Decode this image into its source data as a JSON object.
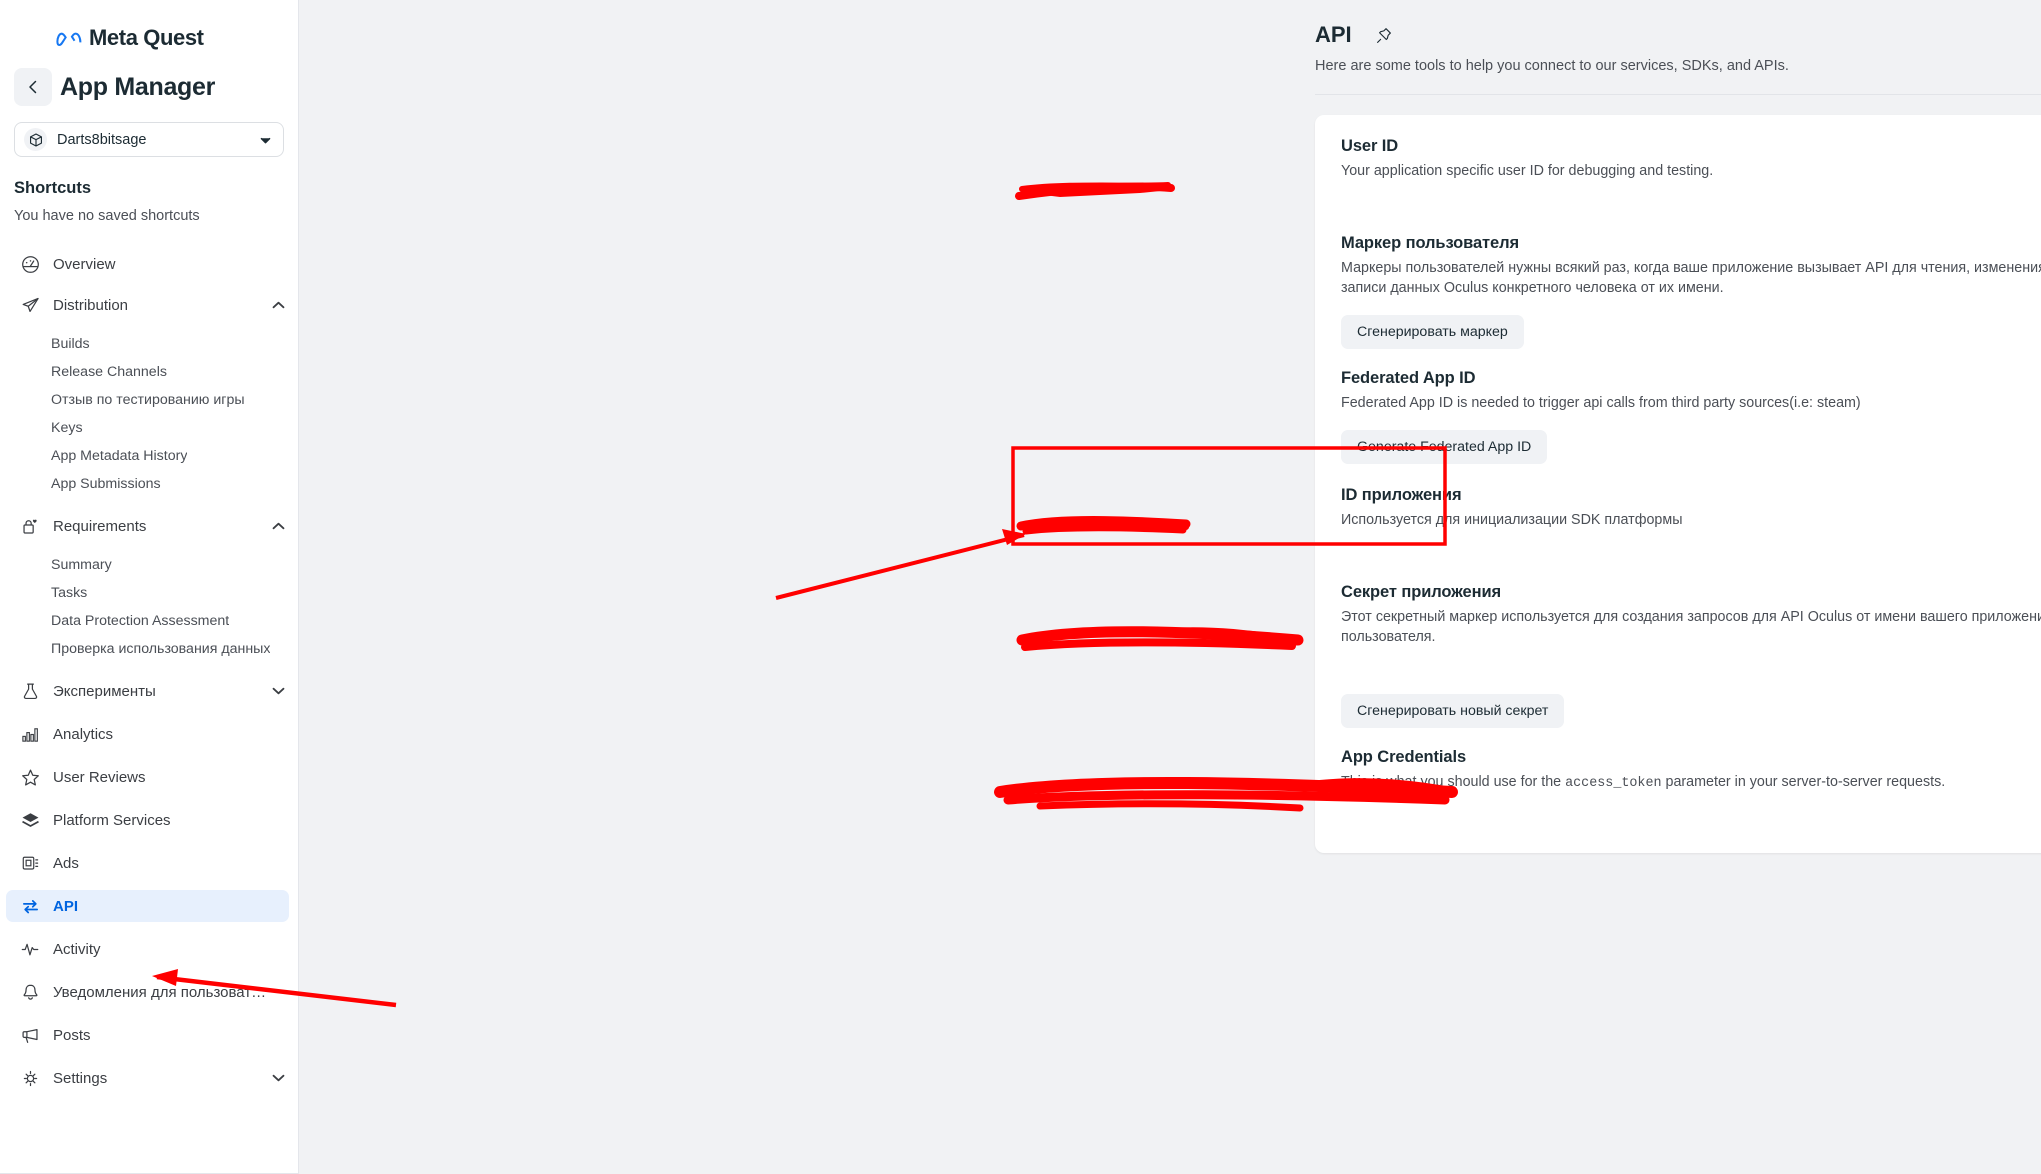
{
  "brand": {
    "name": "Meta Quest",
    "logo_icon": "meta-infinity-logo"
  },
  "sidebar": {
    "back_icon": "chevron-left-icon",
    "page_title": "App Manager",
    "app_selector": {
      "icon": "cube-icon",
      "value": "Darts8bitsage",
      "caret_icon": "chevron-down-icon"
    },
    "shortcuts_heading": "Shortcuts",
    "shortcuts_empty": "You have no saved shortcuts",
    "nav": [
      {
        "label": "Overview",
        "icon": "gauge-icon",
        "type": "item",
        "active": false
      },
      {
        "label": "Distribution",
        "icon": "paper-plane-icon",
        "type": "item",
        "active": false,
        "chevron": "chevron-up-icon"
      },
      {
        "label": "Builds",
        "type": "sub"
      },
      {
        "label": "Release Channels",
        "type": "sub"
      },
      {
        "label": "Отзыв по тестированию игры",
        "type": "sub"
      },
      {
        "label": "Keys",
        "type": "sub"
      },
      {
        "label": "App Metadata History",
        "type": "sub"
      },
      {
        "label": "App Submissions",
        "type": "sub"
      },
      {
        "label": "Requirements",
        "icon": "lock-heart-icon",
        "type": "item",
        "active": false,
        "chevron": "chevron-up-icon"
      },
      {
        "label": "Summary",
        "type": "sub"
      },
      {
        "label": "Tasks",
        "type": "sub"
      },
      {
        "label": "Data Protection Assessment",
        "type": "sub"
      },
      {
        "label": "Проверка использования данных",
        "type": "sub"
      },
      {
        "label": "Эксперименты",
        "icon": "flask-icon",
        "type": "item",
        "active": false,
        "chevron": "chevron-down-icon"
      },
      {
        "label": "Analytics",
        "icon": "bar-chart-icon",
        "type": "item",
        "active": false
      },
      {
        "label": "User Reviews",
        "icon": "star-icon",
        "type": "item",
        "active": false
      },
      {
        "label": "Platform Services",
        "icon": "layers-icon",
        "type": "item",
        "active": false
      },
      {
        "label": "Ads",
        "icon": "ads-icon",
        "type": "item",
        "active": false
      },
      {
        "label": "API",
        "icon": "swap-arrows-icon",
        "type": "item",
        "active": true
      },
      {
        "label": "Activity",
        "icon": "pulse-icon",
        "type": "item",
        "active": false
      },
      {
        "label": "Уведомления для пользоват…",
        "icon": "bell-icon",
        "type": "item",
        "active": false
      },
      {
        "label": "Posts",
        "icon": "megaphone-icon",
        "type": "item",
        "active": false
      },
      {
        "label": "Settings",
        "icon": "gear-icon",
        "type": "item",
        "active": false,
        "chevron": "chevron-down-icon"
      }
    ]
  },
  "main": {
    "title": "API",
    "pin_icon": "pushpin-icon",
    "subtitle": "Here are some tools to help you connect to our services, SDKs, and APIs.",
    "sections": [
      {
        "id": "user-id",
        "heading": "User ID",
        "description": "Your application specific user ID for debugging and testing.",
        "value_redacted": true,
        "button": null
      },
      {
        "id": "user-token",
        "heading": "Маркер пользователя",
        "description": "Маркеры пользователей нужны всякий раз, когда ваше приложение вызывает API для чтения, изменения или записи данных Oculus конкретного человека от их имени.",
        "value_redacted": false,
        "button": "Сгенерировать маркер"
      },
      {
        "id": "federated-app-id",
        "heading": "Federated App ID",
        "description": "Federated App ID is needed to trigger api calls from third party sources(i.e: steam)",
        "value_redacted": false,
        "button": "Generate Federated App ID"
      },
      {
        "id": "app-id",
        "heading": "ID приложения",
        "description": "Используется для инициализации SDK платформы",
        "value_redacted": true,
        "button": null,
        "highlighted": true
      },
      {
        "id": "app-secret",
        "heading": "Секрет приложения",
        "description": "Этот секретный маркер используется для создания запросов для API Oculus от имени вашего приложения, а не пользователя.",
        "value_redacted": true,
        "button": "Сгенерировать новый секрет"
      },
      {
        "id": "app-credentials",
        "heading": "App Credentials",
        "description_pre": "This is what you should use for the ",
        "description_code": "access_token",
        "description_post": " parameter in your server-to-server requests.",
        "value_redacted": true,
        "button": null
      }
    ]
  },
  "annotations": {
    "highlight_color": "#ff0000",
    "redaction_color": "#ff0000",
    "arrow_to_app_id": "red-arrow-pointing-to-app-id",
    "arrow_to_api_nav": "red-arrow-pointing-to-api-nav-item"
  },
  "colors": {
    "accent": "#0064e0",
    "nav_active_bg": "#e7f0fd",
    "page_bg": "#f1f2f4",
    "card_bg": "#ffffff",
    "text_primary": "#1c2b33",
    "text_secondary": "#4b4f56"
  }
}
